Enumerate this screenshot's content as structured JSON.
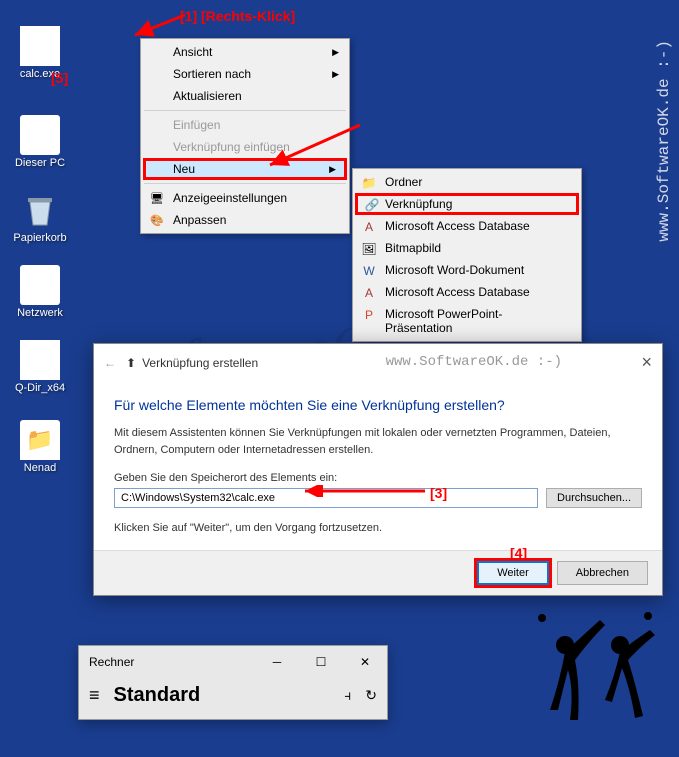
{
  "desktop_icons": {
    "calc": "calc.exe",
    "pc": "Dieser PC",
    "bin": "Papierkorb",
    "network": "Netzwerk",
    "qdir": "Q-Dir_x64",
    "user": "Nenad"
  },
  "context_menu": {
    "view": "Ansicht",
    "sort": "Sortieren nach",
    "refresh": "Aktualisieren",
    "paste": "Einfügen",
    "paste_link": "Verknüpfung einfügen",
    "new": "Neu",
    "display": "Anzeigeeinstellungen",
    "personalize": "Anpassen"
  },
  "submenu": {
    "folder": "Ordner",
    "shortcut": "Verknüpfung",
    "access": "Microsoft Access Database",
    "bitmap": "Bitmapbild",
    "word": "Microsoft Word-Dokument",
    "access2": "Microsoft Access Database",
    "ppt": "Microsoft PowerPoint-Präsentation"
  },
  "wizard": {
    "title_prefix": "←",
    "title": "Verknüpfung erstellen",
    "heading": "Für welche Elemente möchten Sie eine Verknüpfung erstellen?",
    "desc": "Mit diesem Assistenten können Sie Verknüpfungen mit lokalen oder vernetzten Programmen, Dateien, Ordnern, Computern oder Internetadressen erstellen.",
    "field_label": "Geben Sie den Speicherort des Elements ein:",
    "input_value": "C:\\Windows\\System32\\calc.exe",
    "browse": "Durchsuchen...",
    "hint": "Klicken Sie auf \"Weiter\", um den Vorgang fortzusetzen.",
    "next": "Weiter",
    "cancel": "Abbrechen"
  },
  "calc": {
    "title": "Rechner",
    "mode": "Standard"
  },
  "annotations": {
    "a1": "[1]  [Rechts-Klick]",
    "a3": "[3]",
    "a4": "[4]",
    "a5": "[5]"
  },
  "watermark": "www.SoftwareOK.de :-)",
  "watermark_inline": "www.SoftwareOK.de :-)"
}
